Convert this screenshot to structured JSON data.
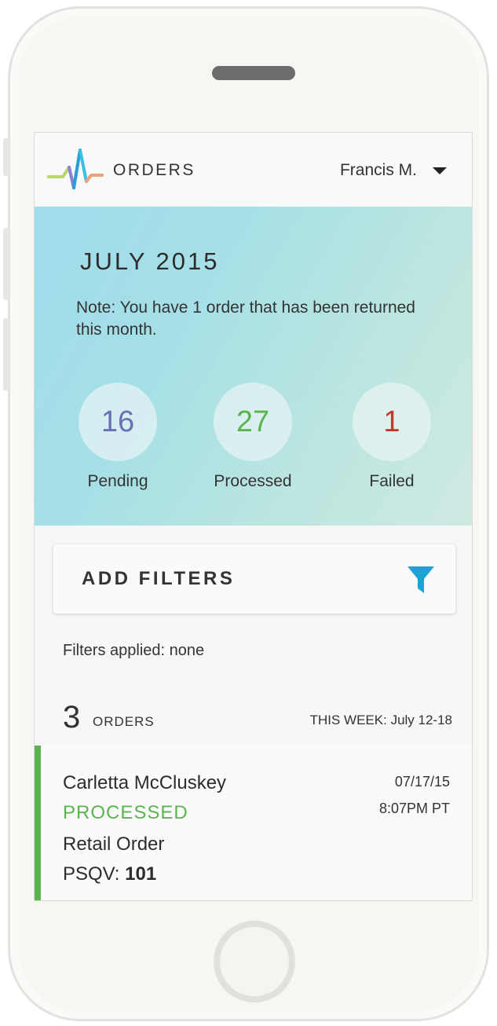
{
  "header": {
    "title": "ORDERS",
    "user": "Francis M.",
    "logo_icon": "pulse-logo-icon",
    "menu_icon": "caret-down-icon"
  },
  "summary": {
    "month": "JULY 2015",
    "note": "Note: You have 1 order that has been returned this month.",
    "stats": [
      {
        "value": "16",
        "label": "Pending",
        "color": "#6a6fb4"
      },
      {
        "value": "27",
        "label": "Processed",
        "color": "#5bb54e"
      },
      {
        "value": "1",
        "label": "Failed",
        "color": "#c0392b"
      }
    ]
  },
  "filters": {
    "button_label": "ADD FILTERS",
    "icon": "filter-icon",
    "icon_color": "#1aa3d4",
    "applied_text": "Filters applied: none"
  },
  "orders": {
    "count": "3",
    "count_label": "ORDERS",
    "period": "THIS WEEK: July 12-18",
    "items": [
      {
        "name": "Carletta McCluskey",
        "status": "PROCESSED",
        "status_color": "#5bb54e",
        "type": "Retail Order",
        "psqv_label": "PSQV:",
        "psqv_value": "101",
        "date": "07/17/15",
        "time": "8:07PM PT"
      }
    ]
  }
}
